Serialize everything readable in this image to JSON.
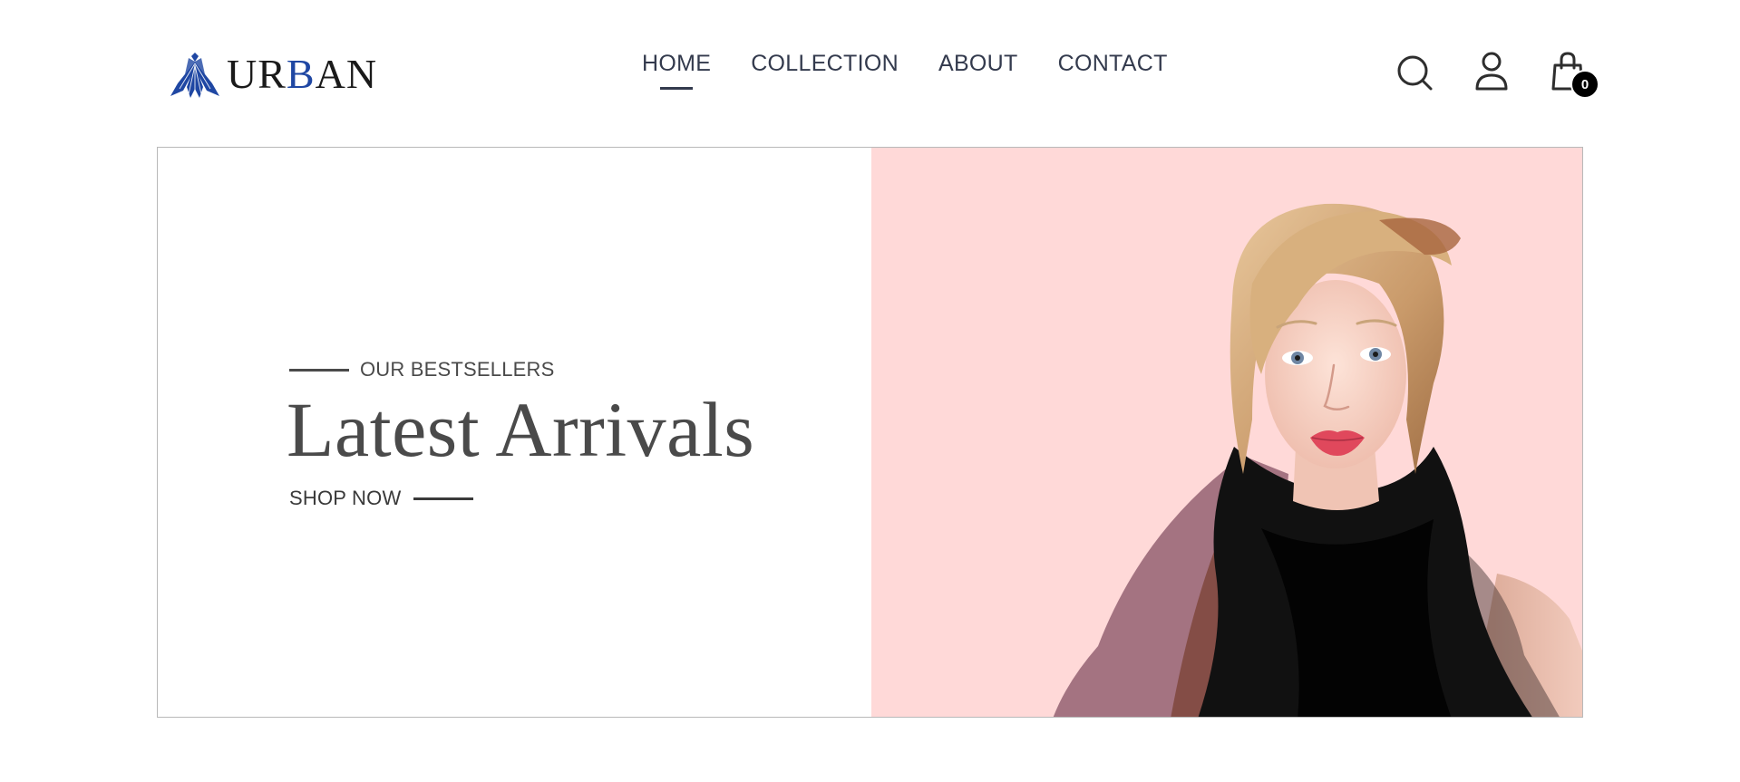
{
  "brand": {
    "name_pre": "UR",
    "name_accent": "B",
    "name_post": "AN",
    "accent_color": "#1f47a3",
    "logo_icon": "fan-dress-emblem-icon"
  },
  "nav": {
    "items": [
      {
        "label": "HOME",
        "active": true
      },
      {
        "label": "COLLECTION",
        "active": false
      },
      {
        "label": "ABOUT",
        "active": false
      },
      {
        "label": "CONTACT",
        "active": false
      }
    ]
  },
  "header_icons": {
    "search": "search-icon",
    "account": "user-icon",
    "cart": "shopping-bag-icon",
    "cart_count": "0"
  },
  "hero": {
    "kicker": "OUR BESTSELLERS",
    "headline": "Latest Arrivals",
    "cta": "SHOP NOW",
    "image_background": "#ffd9d8"
  }
}
